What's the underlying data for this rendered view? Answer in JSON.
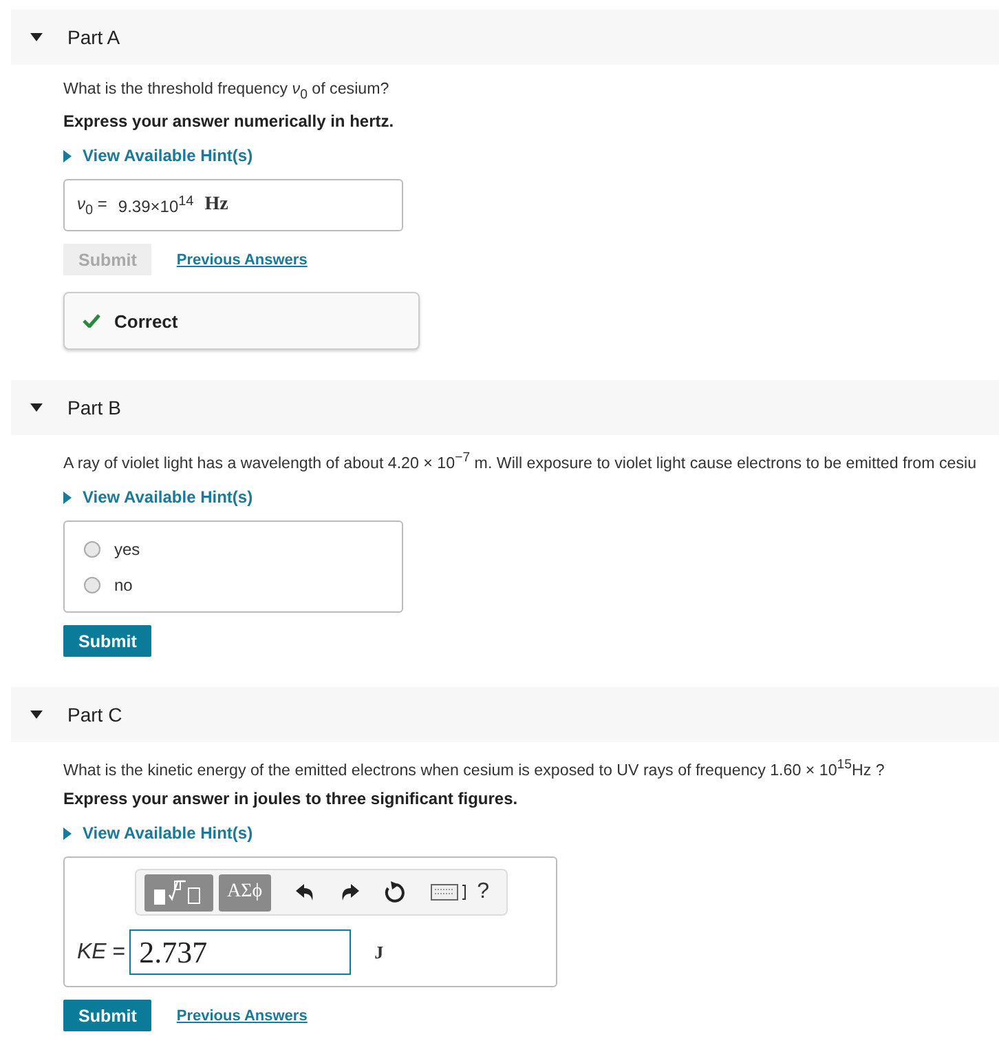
{
  "parts": [
    {
      "kind": "numeric",
      "label": "Part A",
      "expanded": true,
      "question": "What is the threshold frequency *ν*$_{0}$ of cesium?",
      "instruction": "Express your answer numerically in hertz.",
      "hint": "View Available Hint(s)",
      "answer": {
        "symbol": "*ν*$_{0}$ =",
        "value": "9.39×10$^{14}$",
        "unit": "Hz"
      },
      "submit": {
        "label": "Submit",
        "disabled": true
      },
      "previous": "Previous Answers",
      "feedback": {
        "label": "Correct",
        "correct": true
      }
    },
    {
      "kind": "choice",
      "label": "Part B",
      "expanded": true,
      "question": "A ray of violet light has a wavelength of about 4.20 × 10$^{−7}$ m. Will exposure to violet light cause electrons to be emitted from cesiu",
      "hint": "View Available Hint(s)",
      "options": [
        {
          "label": "yes",
          "selected": false
        },
        {
          "label": "no",
          "selected": false
        }
      ],
      "submit": {
        "label": "Submit",
        "disabled": false
      }
    },
    {
      "kind": "editor",
      "label": "Part C",
      "expanded": true,
      "question": "What is the kinetic energy of the emitted electrons when cesium is exposed to UV rays of frequency 1.60 × 10$^{15}$Hz ?",
      "instruction": "Express your answer in joules to three significant figures.",
      "hint": "View Available Hint(s)",
      "toolbar": {
        "symbols": "ΑΣϕ",
        "help": "?"
      },
      "answer": {
        "symbol": "*KE* =",
        "value": "2.737",
        "unit": "J"
      },
      "submit": {
        "label": "Submit",
        "disabled": false
      },
      "previous": "Previous Answers"
    }
  ]
}
